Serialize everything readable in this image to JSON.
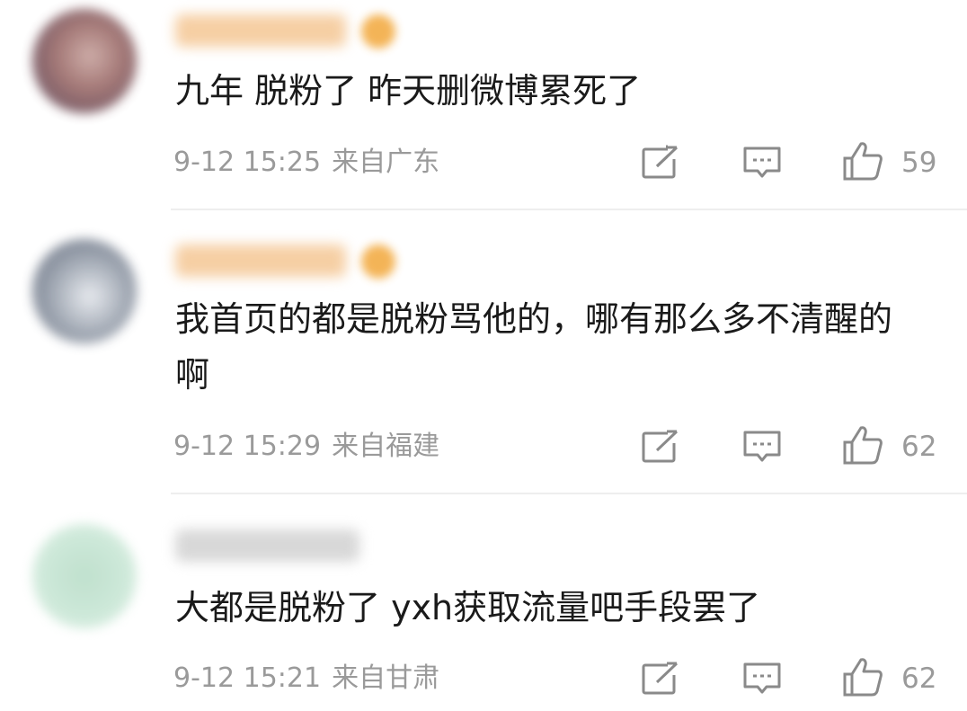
{
  "comments": [
    {
      "text": "九年 脱粉了 昨天删微博累死了",
      "date": "9-12 15:25",
      "location": "来自广东",
      "likes": "59"
    },
    {
      "text": "我首页的都是脱粉骂他的，哪有那么多不清醒的啊",
      "date": "9-12 15:29",
      "location": "来自福建",
      "likes": "62"
    },
    {
      "text": "大都是脱粉了 yxh获取流量吧手段罢了",
      "date": "9-12 15:21",
      "location": "来自甘肃",
      "likes": "62"
    }
  ],
  "icons": {
    "share": "share-icon",
    "reply": "comment-icon",
    "like": "thumbs-up-icon"
  },
  "colors": {
    "meta_text": "#9a9a9a",
    "icon_stroke": "#8a8a8a",
    "body_text": "#1a1a1a"
  }
}
